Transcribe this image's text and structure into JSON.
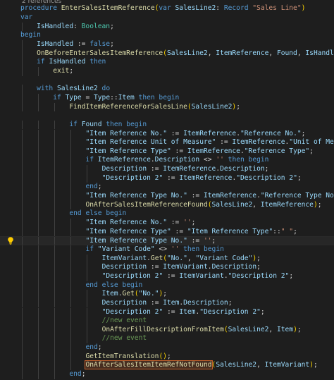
{
  "codelens": "2 references",
  "editor": {
    "lightbulb_line": 26,
    "highlighted_line": 26,
    "lines": [
      {
        "indent": 0,
        "tokens": [
          [
            "kw",
            "procedure "
          ],
          [
            "fn",
            "EnterSalesItemReference"
          ],
          [
            "br1",
            "("
          ],
          [
            "kw",
            "var "
          ],
          [
            "var",
            "SalesLine2"
          ],
          [
            "pl",
            ": "
          ],
          [
            "kw",
            "Record "
          ],
          [
            "str",
            "\"Sales Line\""
          ],
          [
            "br1",
            ")"
          ]
        ]
      },
      {
        "indent": 0,
        "tokens": [
          [
            "kw",
            "var"
          ]
        ]
      },
      {
        "indent": 4,
        "tokens": [
          [
            "var",
            "IsHandled"
          ],
          [
            "pl",
            ": "
          ],
          [
            "type",
            "Boolean"
          ],
          [
            "pl",
            ";"
          ]
        ]
      },
      {
        "indent": 0,
        "tokens": [
          [
            "kw",
            "begin"
          ]
        ]
      },
      {
        "indent": 4,
        "tokens": [
          [
            "var",
            "IsHandled"
          ],
          [
            "pl",
            " := "
          ],
          [
            "kw",
            "false"
          ],
          [
            "pl",
            ";"
          ]
        ]
      },
      {
        "indent": 4,
        "tokens": [
          [
            "fn",
            "OnBeforeEnterSalesItemReference"
          ],
          [
            "br1",
            "("
          ],
          [
            "var",
            "SalesLine2"
          ],
          [
            "pl",
            ", "
          ],
          [
            "var",
            "ItemReference"
          ],
          [
            "pl",
            ", "
          ],
          [
            "var",
            "Found"
          ],
          [
            "pl",
            ", "
          ],
          [
            "var",
            "IsHandled"
          ],
          [
            "br1",
            ")"
          ],
          [
            "pl",
            ";"
          ]
        ]
      },
      {
        "indent": 4,
        "tokens": [
          [
            "kw",
            "if "
          ],
          [
            "var",
            "IsHandled"
          ],
          [
            "kw",
            " then"
          ]
        ]
      },
      {
        "indent": 8,
        "tokens": [
          [
            "fn",
            "exit"
          ],
          [
            "pl",
            ";"
          ]
        ]
      },
      {
        "indent": 0,
        "tokens": []
      },
      {
        "indent": 4,
        "tokens": [
          [
            "kw",
            "with "
          ],
          [
            "var",
            "SalesLine2"
          ],
          [
            "kw",
            " do"
          ]
        ]
      },
      {
        "indent": 8,
        "tokens": [
          [
            "kw",
            "if "
          ],
          [
            "var",
            "Type"
          ],
          [
            "pl",
            " = "
          ],
          [
            "var",
            "Type"
          ],
          [
            "pl",
            "::"
          ],
          [
            "var",
            "Item"
          ],
          [
            "kw",
            " then begin"
          ]
        ]
      },
      {
        "indent": 12,
        "tokens": [
          [
            "fn",
            "FindItemReferenceForSalesLine"
          ],
          [
            "br1",
            "("
          ],
          [
            "var",
            "SalesLine2"
          ],
          [
            "br1",
            ")"
          ],
          [
            "pl",
            ";"
          ]
        ]
      },
      {
        "indent": 0,
        "tokens": []
      },
      {
        "indent": 12,
        "tokens": [
          [
            "kw",
            "if "
          ],
          [
            "var",
            "Found"
          ],
          [
            "kw",
            " then begin"
          ]
        ]
      },
      {
        "indent": 16,
        "tokens": [
          [
            "var",
            "\"Item Reference No.\""
          ],
          [
            "pl",
            " := "
          ],
          [
            "var",
            "ItemReference"
          ],
          [
            "pl",
            "."
          ],
          [
            "var",
            "\"Reference No.\""
          ],
          [
            "pl",
            ";"
          ]
        ]
      },
      {
        "indent": 16,
        "tokens": [
          [
            "var",
            "\"Item Reference Unit of Measure\""
          ],
          [
            "pl",
            " := "
          ],
          [
            "var",
            "ItemReference"
          ],
          [
            "pl",
            "."
          ],
          [
            "var",
            "\"Unit of Measure\""
          ],
          [
            "pl",
            ";"
          ]
        ]
      },
      {
        "indent": 16,
        "tokens": [
          [
            "var",
            "\"Item Reference Type\""
          ],
          [
            "pl",
            " := "
          ],
          [
            "var",
            "ItemReference"
          ],
          [
            "pl",
            "."
          ],
          [
            "var",
            "\"Reference Type\""
          ],
          [
            "pl",
            ";"
          ]
        ]
      },
      {
        "indent": 16,
        "tokens": [
          [
            "kw",
            "if "
          ],
          [
            "var",
            "ItemReference"
          ],
          [
            "pl",
            "."
          ],
          [
            "var",
            "Description"
          ],
          [
            "pl",
            " <> "
          ],
          [
            "str",
            "''"
          ],
          [
            "kw",
            " then begin"
          ]
        ]
      },
      {
        "indent": 20,
        "tokens": [
          [
            "var",
            "Description"
          ],
          [
            "pl",
            " := "
          ],
          [
            "var",
            "ItemReference"
          ],
          [
            "pl",
            "."
          ],
          [
            "var",
            "Description"
          ],
          [
            "pl",
            ";"
          ]
        ]
      },
      {
        "indent": 20,
        "tokens": [
          [
            "var",
            "\"Description 2\""
          ],
          [
            "pl",
            " := "
          ],
          [
            "var",
            "ItemReference"
          ],
          [
            "pl",
            "."
          ],
          [
            "var",
            "\"Description 2\""
          ],
          [
            "pl",
            ";"
          ]
        ]
      },
      {
        "indent": 16,
        "tokens": [
          [
            "kw",
            "end"
          ],
          [
            "pl",
            ";"
          ]
        ]
      },
      {
        "indent": 16,
        "tokens": [
          [
            "var",
            "\"Item Reference Type No.\""
          ],
          [
            "pl",
            " := "
          ],
          [
            "var",
            "ItemReference"
          ],
          [
            "pl",
            "."
          ],
          [
            "var",
            "\"Reference Type No.\""
          ],
          [
            "pl",
            ";"
          ]
        ]
      },
      {
        "indent": 16,
        "tokens": [
          [
            "fn",
            "OnAfterSalesItemReferenceFound"
          ],
          [
            "br1",
            "("
          ],
          [
            "var",
            "SalesLine2"
          ],
          [
            "pl",
            ", "
          ],
          [
            "var",
            "ItemReference"
          ],
          [
            "br1",
            ")"
          ],
          [
            "pl",
            ";"
          ]
        ]
      },
      {
        "indent": 12,
        "tokens": [
          [
            "kw",
            "end else begin"
          ]
        ]
      },
      {
        "indent": 16,
        "tokens": [
          [
            "var",
            "\"Item Reference No.\""
          ],
          [
            "pl",
            " := "
          ],
          [
            "str",
            "''"
          ],
          [
            "pl",
            ";"
          ]
        ]
      },
      {
        "indent": 16,
        "tokens": [
          [
            "var",
            "\"Item Reference Type\""
          ],
          [
            "pl",
            " := "
          ],
          [
            "var",
            "\"Item Reference Type\""
          ],
          [
            "pl",
            "::"
          ],
          [
            "str",
            "\" \""
          ],
          [
            "pl",
            ";"
          ]
        ]
      },
      {
        "indent": 16,
        "tokens": [
          [
            "var",
            "\"Item Reference Type No.\""
          ],
          [
            "pl",
            " := "
          ],
          [
            "str",
            "''"
          ],
          [
            "pl",
            ";"
          ]
        ]
      },
      {
        "indent": 16,
        "tokens": [
          [
            "kw",
            "if "
          ],
          [
            "var",
            "\"Variant Code\""
          ],
          [
            "pl",
            " <> "
          ],
          [
            "str",
            "''"
          ],
          [
            "kw",
            " then begin"
          ]
        ]
      },
      {
        "indent": 20,
        "tokens": [
          [
            "var",
            "ItemVariant"
          ],
          [
            "pl",
            "."
          ],
          [
            "fn",
            "Get"
          ],
          [
            "br1",
            "("
          ],
          [
            "var",
            "\"No.\""
          ],
          [
            "pl",
            ", "
          ],
          [
            "var",
            "\"Variant Code\""
          ],
          [
            "br1",
            ")"
          ],
          [
            "pl",
            ";"
          ]
        ]
      },
      {
        "indent": 20,
        "tokens": [
          [
            "var",
            "Description"
          ],
          [
            "pl",
            " := "
          ],
          [
            "var",
            "ItemVariant"
          ],
          [
            "pl",
            "."
          ],
          [
            "var",
            "Description"
          ],
          [
            "pl",
            ";"
          ]
        ]
      },
      {
        "indent": 20,
        "tokens": [
          [
            "var",
            "\"Description 2\""
          ],
          [
            "pl",
            " := "
          ],
          [
            "var",
            "ItemVariant"
          ],
          [
            "pl",
            "."
          ],
          [
            "var",
            "\"Description 2\""
          ],
          [
            "pl",
            ";"
          ]
        ]
      },
      {
        "indent": 16,
        "tokens": [
          [
            "kw",
            "end else begin"
          ]
        ]
      },
      {
        "indent": 20,
        "tokens": [
          [
            "var",
            "Item"
          ],
          [
            "pl",
            "."
          ],
          [
            "fn",
            "Get"
          ],
          [
            "br1",
            "("
          ],
          [
            "var",
            "\"No.\""
          ],
          [
            "br1",
            ")"
          ],
          [
            "pl",
            ";"
          ]
        ]
      },
      {
        "indent": 20,
        "tokens": [
          [
            "var",
            "Description"
          ],
          [
            "pl",
            " := "
          ],
          [
            "var",
            "Item"
          ],
          [
            "pl",
            "."
          ],
          [
            "var",
            "Description"
          ],
          [
            "pl",
            ";"
          ]
        ]
      },
      {
        "indent": 20,
        "tokens": [
          [
            "var",
            "\"Description 2\""
          ],
          [
            "pl",
            " := "
          ],
          [
            "var",
            "Item"
          ],
          [
            "pl",
            "."
          ],
          [
            "var",
            "\"Description 2\""
          ],
          [
            "pl",
            ";"
          ]
        ]
      },
      {
        "indent": 20,
        "tokens": [
          [
            "cmt",
            "//new event"
          ]
        ]
      },
      {
        "indent": 20,
        "tokens": [
          [
            "fn",
            "OnAfterFillDescriptionFromItem"
          ],
          [
            "br1",
            "("
          ],
          [
            "var",
            "SalesLine2"
          ],
          [
            "pl",
            ", "
          ],
          [
            "var",
            "Item"
          ],
          [
            "br1",
            ")"
          ],
          [
            "pl",
            ";"
          ]
        ]
      },
      {
        "indent": 20,
        "tokens": [
          [
            "cmt",
            "//new event"
          ]
        ]
      },
      {
        "indent": 16,
        "tokens": [
          [
            "kw",
            "end"
          ],
          [
            "pl",
            ";"
          ]
        ]
      },
      {
        "indent": 16,
        "tokens": [
          [
            "fn",
            "GetItemTranslation"
          ],
          [
            "br1",
            "()"
          ],
          [
            "pl",
            ";"
          ]
        ]
      },
      {
        "indent": 16,
        "tokens": [
          [
            "fn",
            "OnAfterSalesItemItemRefNotFound",
            "hl"
          ],
          [
            "br1",
            "("
          ],
          [
            "var",
            "SalesLine2"
          ],
          [
            "pl",
            ", "
          ],
          [
            "var",
            "ItemVariant"
          ],
          [
            "br1",
            ")"
          ],
          [
            "pl",
            ";"
          ]
        ]
      },
      {
        "indent": 12,
        "tokens": [
          [
            "kw",
            "end"
          ],
          [
            "pl",
            ";"
          ]
        ]
      }
    ]
  },
  "colors": {
    "background": "#1e1e1e",
    "keyword": "#569cd6",
    "function": "#dcdcaa",
    "variable": "#9cdcfe",
    "string": "#ce9178",
    "comment": "#6a9955",
    "type": "#4ec9b0",
    "bracket": "#ffd700",
    "highlight_border": "#c4612b",
    "lightbulb": "#ffcc00"
  },
  "icons": {
    "lightbulb": "lightbulb-icon"
  }
}
